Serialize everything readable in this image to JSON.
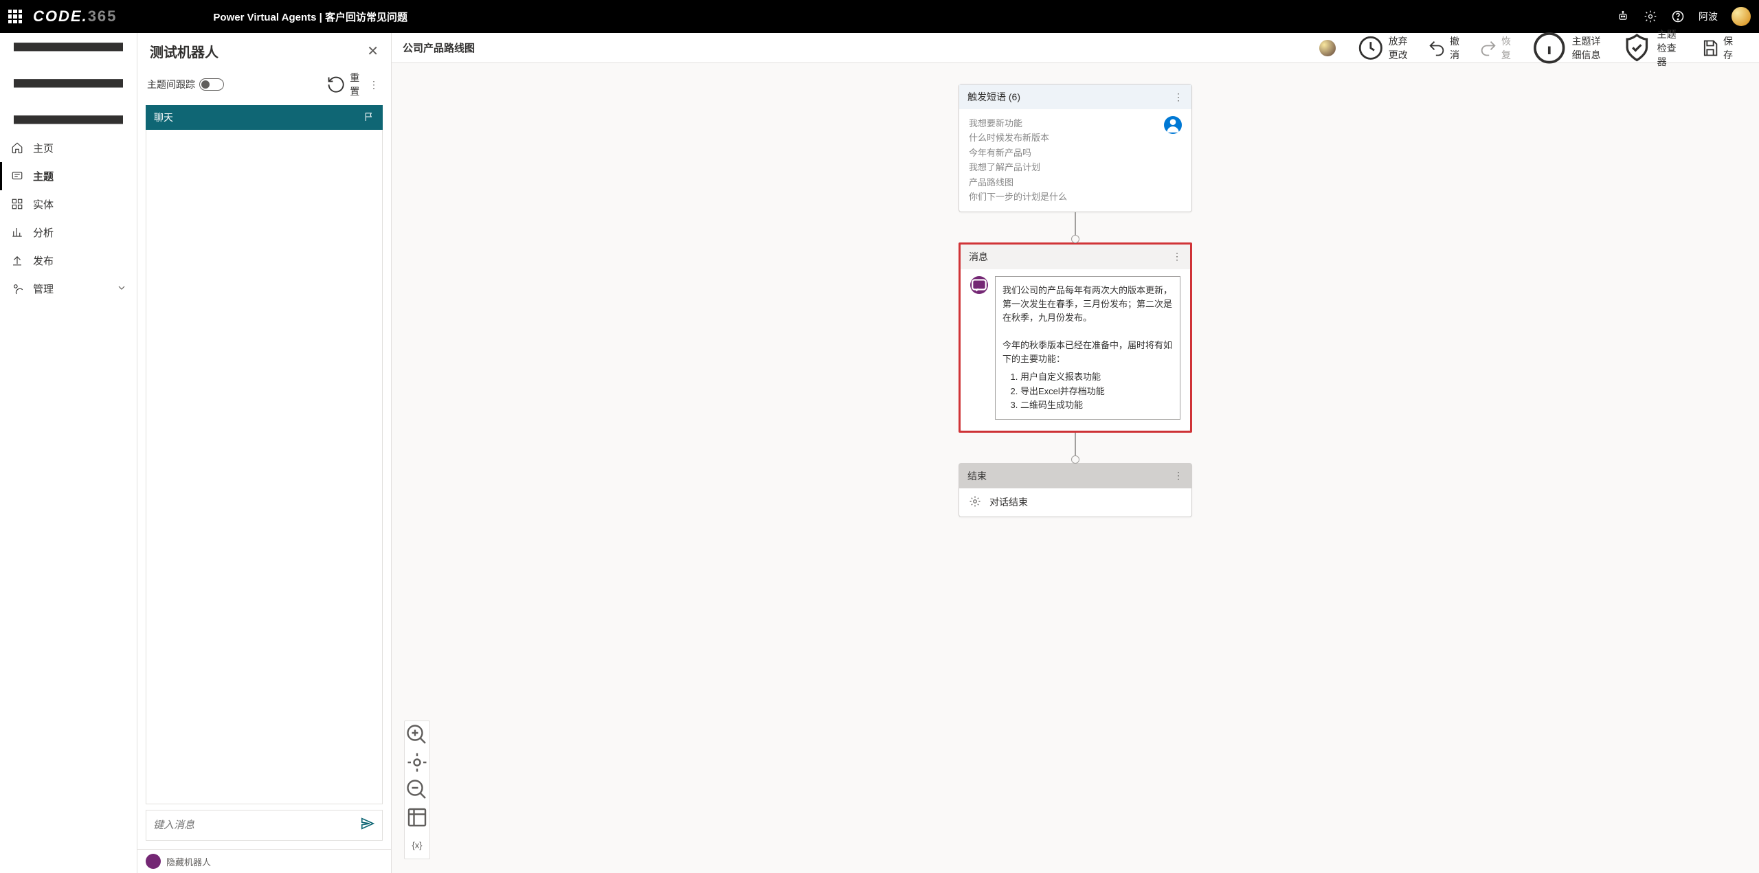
{
  "header": {
    "logo": "CODE.365",
    "app_title": "Power Virtual Agents | 客户回访常见问题",
    "username": "阿波"
  },
  "nav": {
    "items": [
      {
        "label": "主页"
      },
      {
        "label": "主题"
      },
      {
        "label": "实体"
      },
      {
        "label": "分析"
      },
      {
        "label": "发布"
      },
      {
        "label": "管理"
      }
    ]
  },
  "test_panel": {
    "title": "测试机器人",
    "track_label": "主题间跟踪",
    "reset_label": "重置",
    "chat_tab": "聊天",
    "input_placeholder": "键入消息",
    "collapsed_label": "隐藏机器人"
  },
  "canvas": {
    "topic_name": "公司产品路线图",
    "actions": {
      "discard": "放弃更改",
      "undo": "撤消",
      "redo": "恢复",
      "details": "主题详细信息",
      "checker": "主题检查器",
      "save": "保存"
    },
    "trigger": {
      "title": "触发短语 (6)",
      "phrases": [
        "我想要新功能",
        "什么时候发布新版本",
        "今年有新产品吗",
        "我想了解产品计划",
        "产品路线图",
        "你们下一步的计划是什么"
      ]
    },
    "message": {
      "title": "消息",
      "p1": "我们公司的产品每年有两次大的版本更新，第一次发生在春季，三月份发布；第二次是在秋季，九月份发布。",
      "p2": "今年的秋季版本已经在准备中，届时将有如下的主要功能：",
      "items": [
        "用户自定义报表功能",
        "导出Excel并存档功能",
        "二维码生成功能"
      ]
    },
    "end": {
      "title": "结束",
      "label": "对话结束"
    }
  }
}
